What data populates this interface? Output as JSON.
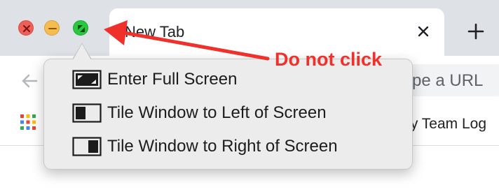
{
  "window": {
    "controls": [
      "close",
      "minimize",
      "fullscreen"
    ],
    "tab": {
      "title": "New Tab",
      "close_icon": "close-icon"
    },
    "new_tab_icon": "plus-icon"
  },
  "toolbar": {
    "back_icon": "arrow-left-icon",
    "omnibox_placeholder": "ype a URL"
  },
  "bookmarks": {
    "apps_icon": "apps-grid-icon",
    "visible_item_label": "ty Team Log"
  },
  "menu": {
    "items": [
      {
        "label": "Enter Full Screen",
        "icon": "fullscreen-icon"
      },
      {
        "label": "Tile Window to Left of Screen",
        "icon": "tile-left-icon"
      },
      {
        "label": "Tile Window to Right of Screen",
        "icon": "tile-right-icon"
      }
    ]
  },
  "annotation": {
    "text": "Do not click",
    "color": "#f0302a"
  },
  "colors": {
    "close": "#ee5f57",
    "minimize": "#f5bd4f",
    "fullscreen": "#28c840",
    "titlebar": "#dee1e6"
  }
}
